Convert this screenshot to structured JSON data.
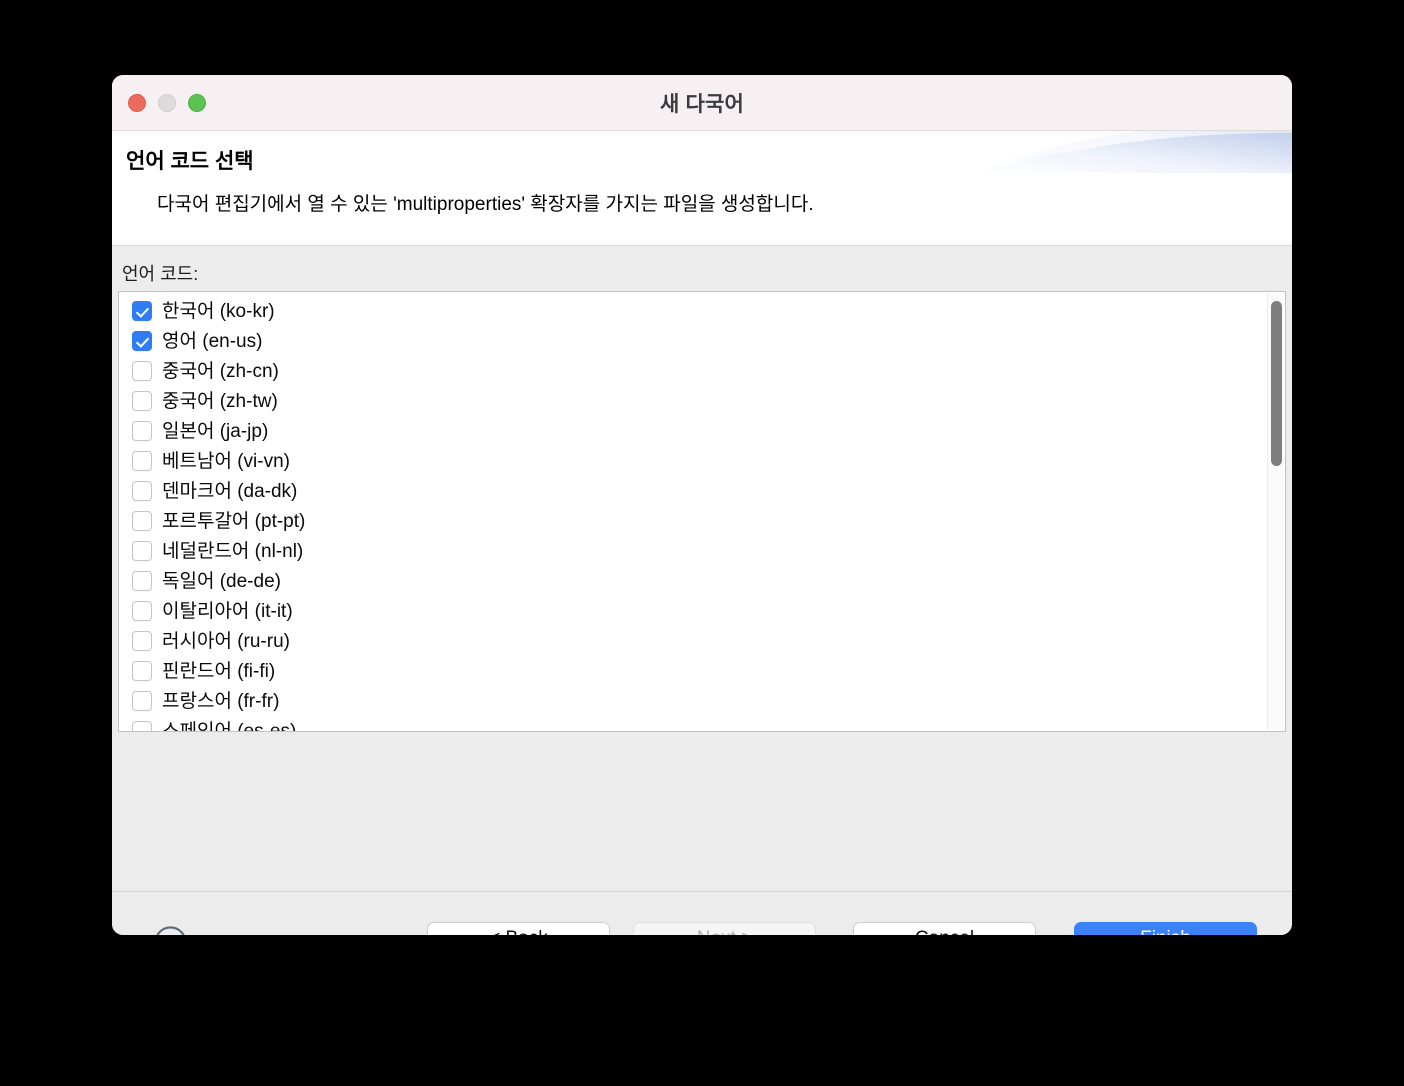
{
  "window": {
    "title": "새 다국어",
    "traffic_lights": [
      {
        "name": "close",
        "color": "#ec6a5e"
      },
      {
        "name": "minimize",
        "color": "#dddbdc"
      },
      {
        "name": "maximize",
        "color": "#5cc254"
      }
    ]
  },
  "banner": {
    "title": "언어 코드 선택",
    "description": "다국어 편집기에서 열 수 있는 'multiproperties' 확장자를 가지는 파일을 생성합니다."
  },
  "main": {
    "list_label": "언어 코드:",
    "languages": [
      {
        "label": "한국어 (ko-kr)",
        "checked": true
      },
      {
        "label": "영어 (en-us)",
        "checked": true
      },
      {
        "label": "중국어 (zh-cn)",
        "checked": false
      },
      {
        "label": "중국어 (zh-tw)",
        "checked": false
      },
      {
        "label": "일본어 (ja-jp)",
        "checked": false
      },
      {
        "label": "베트남어 (vi-vn)",
        "checked": false
      },
      {
        "label": "덴마크어 (da-dk)",
        "checked": false
      },
      {
        "label": "포르투갈어 (pt-pt)",
        "checked": false
      },
      {
        "label": "네덜란드어 (nl-nl)",
        "checked": false
      },
      {
        "label": "독일어 (de-de)",
        "checked": false
      },
      {
        "label": "이탈리아어 (it-it)",
        "checked": false
      },
      {
        "label": "러시아어 (ru-ru)",
        "checked": false
      },
      {
        "label": "핀란드어 (fi-fi)",
        "checked": false
      },
      {
        "label": "프랑스어 (fr-fr)",
        "checked": false
      },
      {
        "label": "스페인어 (es-es)",
        "checked": false
      }
    ],
    "scrollbar": {
      "thumb_color": "#7e7e7e"
    }
  },
  "footer": {
    "help_label": "?",
    "back_label": "< Back",
    "next_label": "Next >",
    "next_disabled": true,
    "cancel_label": "Cancel",
    "finish_label": "Finish",
    "finish_color": "#3b82f6"
  }
}
